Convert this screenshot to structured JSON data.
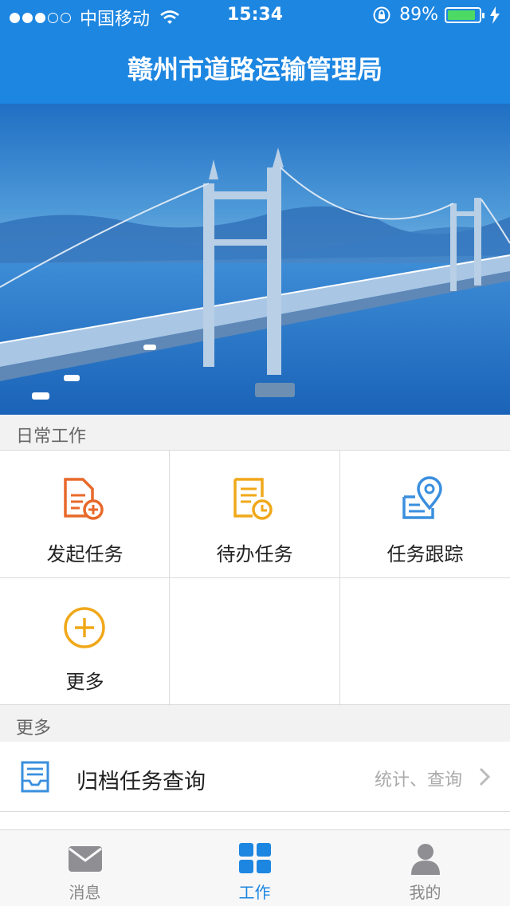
{
  "status_bar": {
    "carrier": "中国移动",
    "time": "15:34",
    "battery": "89%",
    "battery_level": 0.89
  },
  "header": {
    "title": "赣州市道路运输管理局"
  },
  "banner": {
    "image": "suspension-bridge-over-river"
  },
  "daily_work": {
    "section_label": "日常工作",
    "items": [
      {
        "label": "发起任务",
        "icon": "new-document-icon",
        "color": "#e8692a"
      },
      {
        "label": "待办任务",
        "icon": "pending-document-clock-icon",
        "color": "#f0a81a"
      },
      {
        "label": "任务跟踪",
        "icon": "location-tracking-icon",
        "color": "#3a8fde"
      },
      {
        "label": "更多",
        "icon": "plus-circle-icon",
        "color": "#f0a81a"
      }
    ]
  },
  "more": {
    "section_label": "更多",
    "items": [
      {
        "label": "归档任务查询",
        "hint": "统计、查询",
        "icon": "archive-inbox-icon",
        "color": "#3a8fde"
      }
    ]
  },
  "tabbar": {
    "tabs": [
      {
        "label": "消息",
        "icon": "envelope-icon",
        "active": false
      },
      {
        "label": "工作",
        "icon": "grid-icon",
        "active": true
      },
      {
        "label": "我的",
        "icon": "user-icon",
        "active": false
      }
    ],
    "active_color": "#1d86e1",
    "inactive_color": "#8e8e93"
  },
  "colors": {
    "brand": "#1d86e1"
  }
}
